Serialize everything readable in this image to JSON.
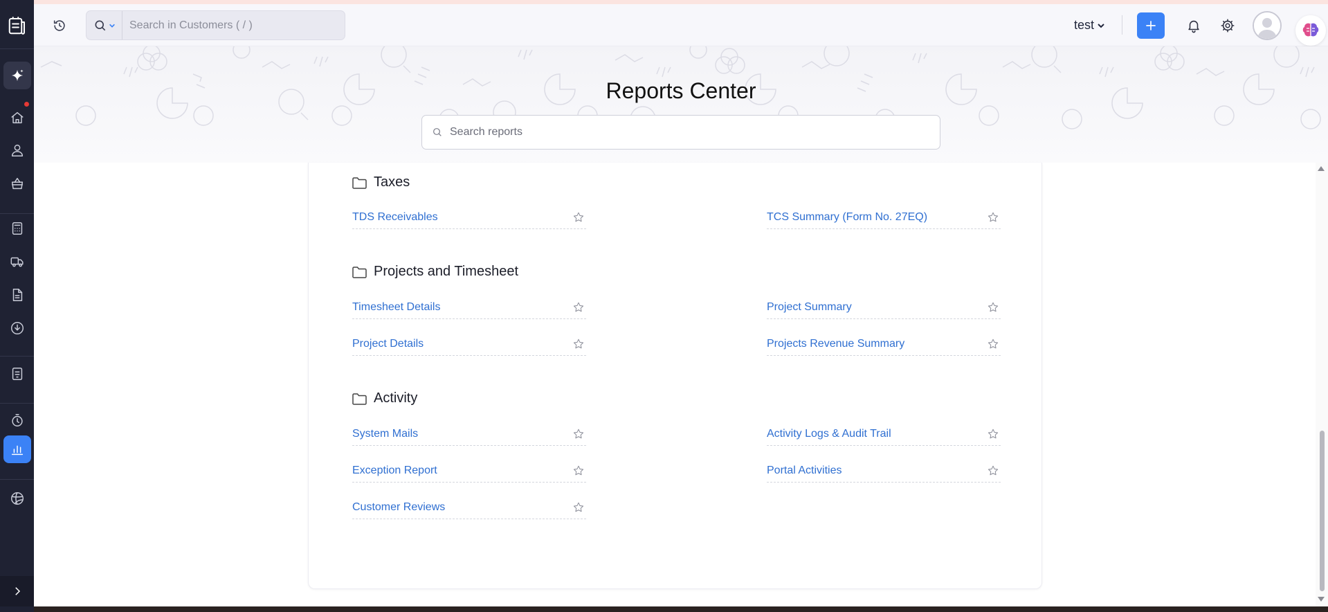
{
  "topbar": {
    "search_placeholder": "Search in Customers ( / )",
    "org_name": "test"
  },
  "banner": {
    "title": "Reports Center",
    "search_placeholder": "Search reports"
  },
  "sidebar": {
    "items": [
      "logo",
      "zia-ai",
      "home",
      "customers",
      "items",
      "accountant",
      "delivery",
      "documents",
      "download",
      "receipts",
      "time-tracking",
      "reports",
      "integrations"
    ],
    "active": "reports"
  },
  "sections": [
    {
      "title": "Taxes",
      "reports": [
        "TDS Receivables",
        "TCS Summary (Form No. 27EQ)"
      ]
    },
    {
      "title": "Projects and Timesheet",
      "reports": [
        "Timesheet Details",
        "Project Summary",
        "Project Details",
        "Projects Revenue Summary"
      ]
    },
    {
      "title": "Activity",
      "reports": [
        "System Mails",
        "Activity Logs & Audit Trail",
        "Exception Report",
        "Portal Activities",
        "Customer Reviews"
      ]
    }
  ],
  "colors": {
    "accent": "#3b82f6",
    "link": "#2f6fd1",
    "sidebar_bg": "#1f2233"
  }
}
